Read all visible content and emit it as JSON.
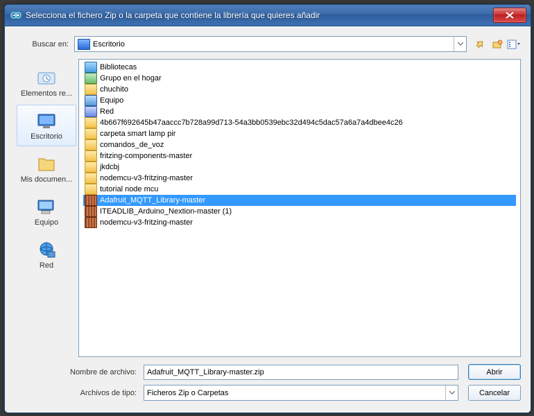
{
  "title": "Selecciona el fichero Zip o la carpeta que contiene la librería que quieres añadir",
  "lookin_label": "Buscar en:",
  "lookin_value": "Escritorio",
  "places": [
    {
      "label": "Elementos re...",
      "icon": "recent"
    },
    {
      "label": "Escritorio",
      "icon": "desktop",
      "selected": true
    },
    {
      "label": "Mis documen...",
      "icon": "docs"
    },
    {
      "label": "Equipo",
      "icon": "computer"
    },
    {
      "label": "Red",
      "icon": "network"
    }
  ],
  "files": [
    {
      "name": "Bibliotecas",
      "icon": "lib"
    },
    {
      "name": "Grupo en el hogar",
      "icon": "group"
    },
    {
      "name": "chuchito",
      "icon": "folder"
    },
    {
      "name": "Equipo",
      "icon": "comp"
    },
    {
      "name": "Red",
      "icon": "net"
    },
    {
      "name": "4b667f692645b47aaccc7b728a99d713-54a3bb0539ebc32d494c5dac57a6a7a4dbee4c26",
      "icon": "folder"
    },
    {
      "name": "carpeta smart lamp pir",
      "icon": "folder"
    },
    {
      "name": "comandos_de_voz",
      "icon": "folder"
    },
    {
      "name": "fritzing-components-master",
      "icon": "folder"
    },
    {
      "name": "jkdcbj",
      "icon": "folder"
    },
    {
      "name": "nodemcu-v3-fritzing-master",
      "icon": "folder"
    },
    {
      "name": "tutorial node mcu",
      "icon": "folder"
    },
    {
      "name": "Adafruit_MQTT_Library-master",
      "icon": "zip",
      "selected": true
    },
    {
      "name": "ITEADLIB_Arduino_Nextion-master (1)",
      "icon": "zip"
    },
    {
      "name": "nodemcu-v3-fritzing-master",
      "icon": "zip"
    }
  ],
  "filename_label": "Nombre de archivo:",
  "filename_value": "Adafruit_MQTT_Library-master.zip",
  "filetype_label": "Archivos de tipo:",
  "filetype_value": "Ficheros Zip o Carpetas",
  "open_label": "Abrir",
  "cancel_label": "Cancelar"
}
